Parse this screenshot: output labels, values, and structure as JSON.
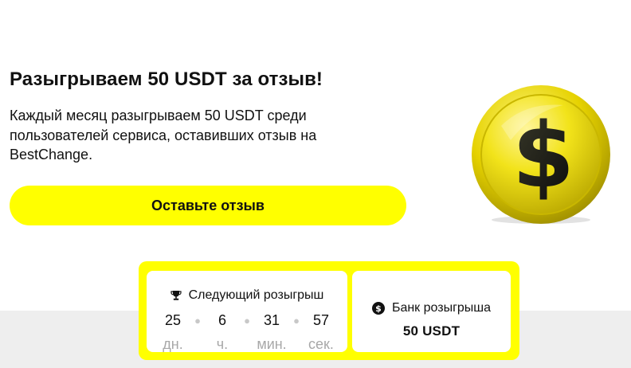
{
  "promo": {
    "title": "Разыгрываем 50 USDT за отзыв!",
    "description": "Каждый месяц разыгрываем 50 USDT среди пользователей сервиса, оставивших отзыв на BestChange.",
    "cta_label": "Оставьте отзыв"
  },
  "draw": {
    "next_label": "Следующий розыгрыш",
    "countdown": [
      {
        "value": "25",
        "unit": "дн."
      },
      {
        "value": "6",
        "unit": "ч."
      },
      {
        "value": "31",
        "unit": "мин."
      },
      {
        "value": "57",
        "unit": "сек."
      }
    ],
    "bank_label": "Банк розыгрыша",
    "bank_value": "50 USDT"
  },
  "icons": {
    "trophy": "trophy-icon",
    "bank": "dollar-coin-icon",
    "coin": "gold-dollar-coin-illustration"
  },
  "colors": {
    "accent": "#ffff00",
    "text": "#111111",
    "muted": "#a8a8a8",
    "band": "#eeeeee"
  }
}
